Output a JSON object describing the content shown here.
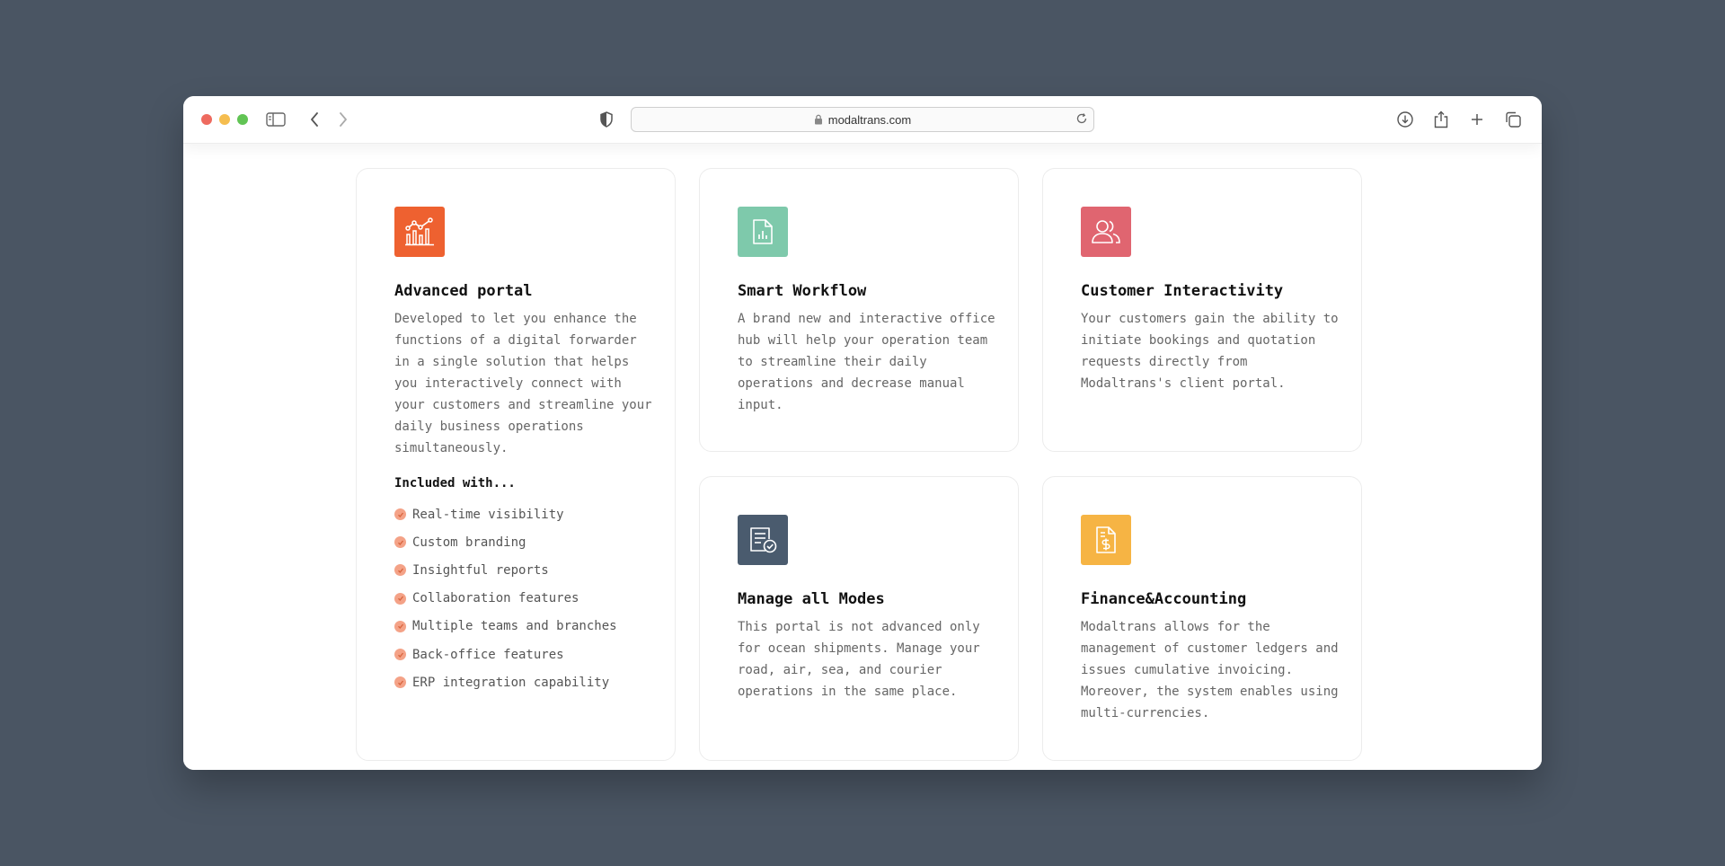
{
  "browser": {
    "url": "modaltrans.com"
  },
  "colors": {
    "background": "#4a5563",
    "advanced_icon": "#ee6130",
    "workflow_icon": "#7ec9ab",
    "customer_icon": "#e06570",
    "modes_icon": "#4a5b6e",
    "finance_icon": "#f6b444",
    "check": "#f4a287"
  },
  "cards": {
    "advanced": {
      "icon": "chart-icon",
      "title": "Advanced portal",
      "description": "Developed to let you enhance the functions of a digital forwarder in a single solution that helps you interactively connect with your customers and streamline your daily business operations simultaneously.",
      "included_title": "Included with...",
      "features": [
        "Real-time visibility",
        "Custom branding",
        "Insightful reports",
        "Collaboration features",
        "Multiple teams and branches",
        "Back-office features",
        "ERP integration capability"
      ]
    },
    "workflow": {
      "icon": "document-chart-icon",
      "title": "Smart Workflow",
      "description": "A brand new and interactive office hub will help your operation team to streamline their daily operations and decrease manual input."
    },
    "customer": {
      "icon": "users-icon",
      "title": "Customer Interactivity",
      "description": "Your customers gain the ability to initiate bookings and quotation requests directly from Modaltrans's client portal."
    },
    "modes": {
      "icon": "document-check-icon",
      "title": "Manage all Modes",
      "description": "This portal is not advanced only for ocean shipments. Manage your road, air, sea, and courier operations in the same place."
    },
    "finance": {
      "icon": "invoice-dollar-icon",
      "title": "Finance&Accounting",
      "description": "Modaltrans allows for the management of customer ledgers and issues cumulative invoicing. Moreover, the system enables using multi-currencies."
    }
  }
}
